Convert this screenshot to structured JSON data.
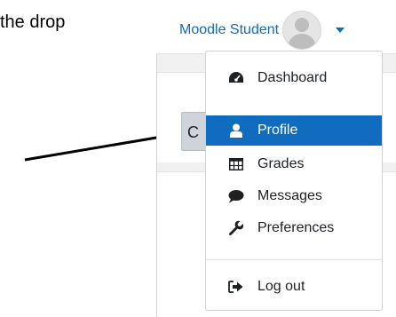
{
  "instruction_text": "the drop",
  "user_menu": {
    "name": "Moodle Student"
  },
  "hidden_button_text": "C",
  "dropdown": {
    "items": [
      {
        "label": "Dashboard",
        "icon": "dashboard-icon"
      },
      {
        "label": "Profile",
        "icon": "user-icon",
        "active": true
      },
      {
        "label": "Grades",
        "icon": "grades-table-icon"
      },
      {
        "label": "Messages",
        "icon": "message-bubble-icon"
      },
      {
        "label": "Preferences",
        "icon": "wrench-icon"
      }
    ],
    "logout": {
      "label": "Log out",
      "icon": "sign-out-icon"
    }
  },
  "colors": {
    "accent": "#0f6cbf",
    "text": "#1d2125"
  }
}
